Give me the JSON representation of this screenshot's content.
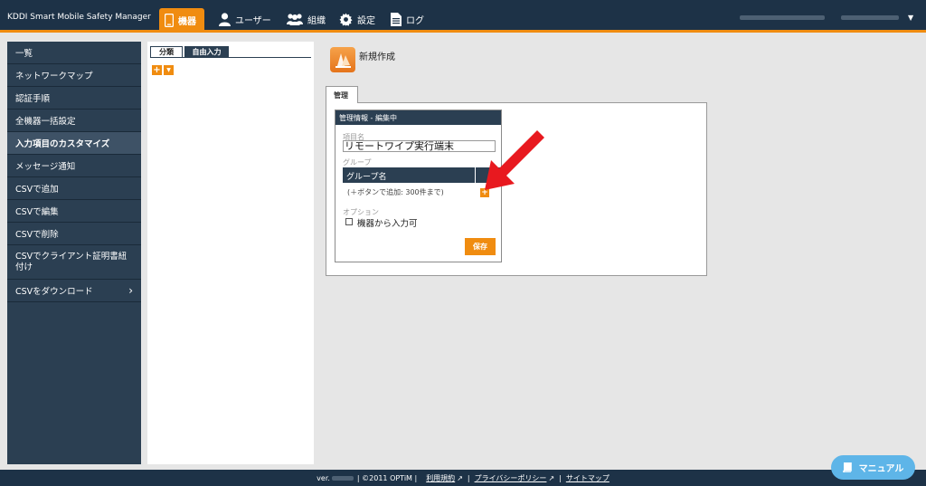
{
  "header": {
    "brand": "KDDI Smart Mobile Safety Manager",
    "nav": {
      "device": "機器",
      "users": "ユーザー",
      "org": "組織",
      "settings": "設定",
      "log": "ログ"
    }
  },
  "sidebar": {
    "items": [
      "一覧",
      "ネットワークマップ",
      "認証手順",
      "全機器一括設定",
      "入力項目のカスタマイズ",
      "メッセージ通知",
      "CSVで追加",
      "CSVで編集",
      "CSVで削除",
      "CSVでクライアント証明書紐付け",
      "CSVをダウンロード"
    ],
    "active_index": 4
  },
  "middle": {
    "tabs": [
      "分類",
      "自由入力"
    ],
    "add_button": "+",
    "dropdown_icon": "caret-down-icon"
  },
  "main": {
    "title": "新規作成",
    "tab": "管理",
    "card": {
      "header": "管理情報 - 編集中",
      "item_label": "項目名",
      "item_value": "リモートワイプ実行端末",
      "group_label": "グループ",
      "group_col": "グループ名",
      "group_hint": "(＋ボタンで追加: 300件まで)",
      "group_add": "+",
      "option_label": "オプション",
      "option_checkbox": "機器から入力可",
      "option_checked": false,
      "save": "保存"
    }
  },
  "footer": {
    "ver": "ver.",
    "copyright": "| ©2011 OPTiM |",
    "terms": "利用規約",
    "privacy": "プライバシーポリシー",
    "sitemap": "サイトマップ"
  },
  "manual_button": "マニュアル",
  "colors": {
    "navy": "#1d3247",
    "sidebar": "#2b3f52",
    "accent": "#f08c10",
    "manual": "#5eb5e8",
    "arrow": "#e8191f"
  }
}
